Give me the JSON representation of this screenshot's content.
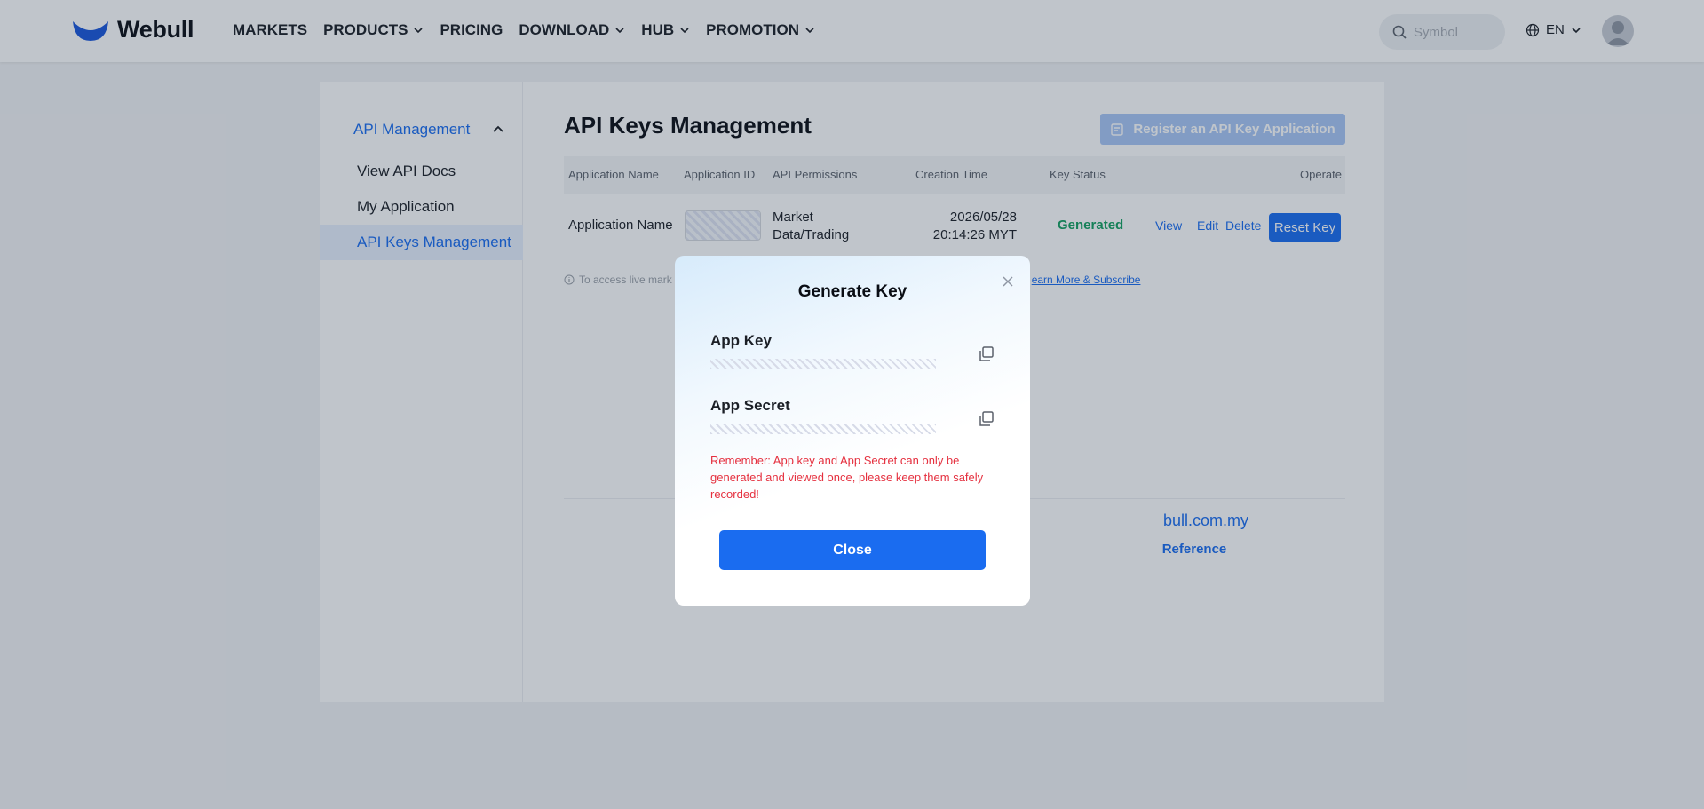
{
  "header": {
    "brand": "Webull",
    "nav": [
      "MARKETS",
      "PRODUCTS",
      "PRICING",
      "DOWNLOAD",
      "HUB",
      "PROMOTION"
    ],
    "search_placeholder": "Symbol",
    "language": "EN"
  },
  "sidebar": {
    "section": "API Management",
    "items": [
      "View API Docs",
      "My Application",
      "API Keys Management"
    ]
  },
  "main": {
    "title": "API Keys Management",
    "register_button": "Register an API Key Application",
    "columns": [
      "Application Name",
      "Application ID",
      "API Permissions",
      "Creation Time",
      "Key Status",
      "Operate"
    ],
    "row": {
      "name": "Application Name",
      "permissions_1": "Market",
      "permissions_2": "Data/Trading",
      "date": "2026/05/28",
      "time": "20:14:26 MYT",
      "status": "Generated",
      "view": "View",
      "edit": "Edit",
      "delete": "Delete",
      "reset": "Reset Key"
    },
    "note_text": "To access live mark",
    "note_link": "earn More & Subscribe",
    "contact_partial": "bull.com.my",
    "reference_partial": "Reference"
  },
  "modal": {
    "title": "Generate Key",
    "app_key_label": "App Key",
    "app_secret_label": "App Secret",
    "warning": "Remember: App key and App Secret can only be generated and viewed once, please keep them safely recorded!",
    "close_button": "Close"
  },
  "colors": {
    "primary": "#1a6cf0",
    "status_green": "#14a060",
    "warning_red": "#e5303f"
  }
}
